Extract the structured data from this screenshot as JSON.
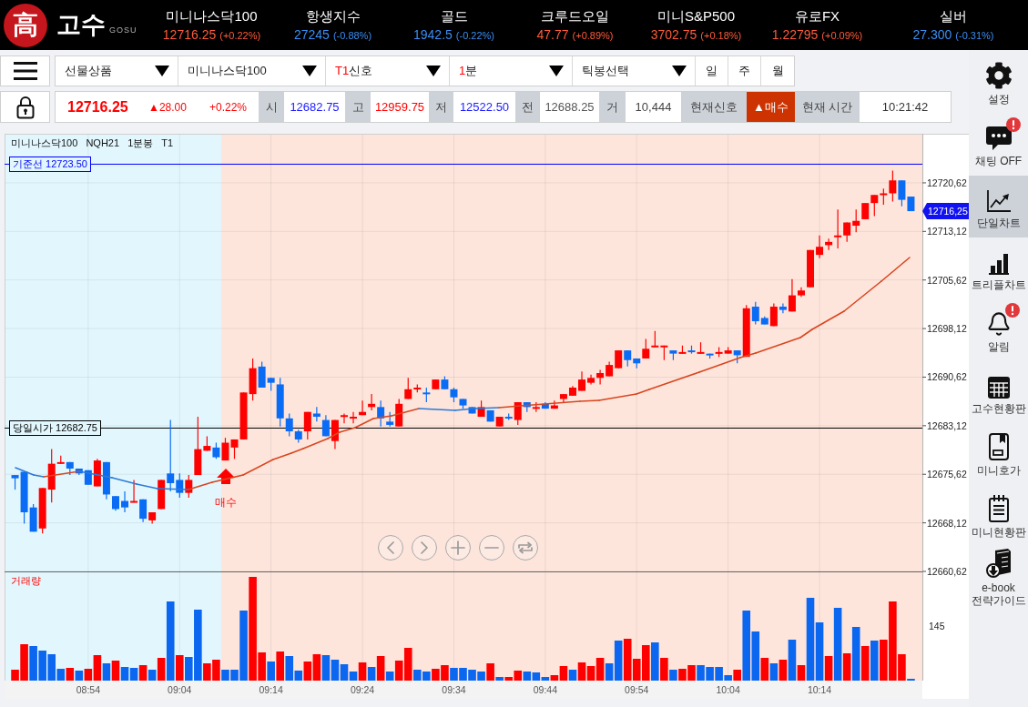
{
  "header": {
    "logo": {
      "emblem": "高",
      "name": "고수",
      "subtitle": "GOSU"
    },
    "tickers": [
      {
        "name": "미니나스닥100",
        "value": "12716.25",
        "change": "(+0.22%)",
        "rising": true
      },
      {
        "name": "항생지수",
        "value": "27245",
        "change": "(-0.88%)",
        "rising": false
      },
      {
        "name": "골드",
        "value": "1942.5",
        "change": "(-0.22%)",
        "rising": false
      },
      {
        "name": "크루드오일",
        "value": "47.77",
        "change": "(+0.89%)",
        "rising": true
      },
      {
        "name": "미니S&P500",
        "value": "3702.75",
        "change": "(+0.18%)",
        "rising": true
      },
      {
        "name": "유로FX",
        "value": "1.22795",
        "change": "(+0.09%)",
        "rising": true
      },
      {
        "name": "실버",
        "value": "27.300",
        "change": "(-0.31%)",
        "rising": false
      }
    ]
  },
  "selectors": [
    {
      "label": "선물상품"
    },
    {
      "label": "미니나스닥100"
    },
    {
      "accent": "T1",
      "label": "신호"
    },
    {
      "accent": "1",
      "label": "분"
    },
    {
      "label": "틱봉선택"
    }
  ],
  "period_buttons": [
    {
      "label": "일"
    },
    {
      "label": "주"
    },
    {
      "label": "월"
    }
  ],
  "quote": {
    "price": "12716.25",
    "change": "▲28.00",
    "rate": "+0.22%",
    "rising": true,
    "fields": [
      {
        "label": "시",
        "value": "12682.75",
        "color": "#1a1aff"
      },
      {
        "label": "고",
        "value": "12959.75",
        "color": "#ff0000"
      },
      {
        "label": "저",
        "value": "12522.50",
        "color": "#1a1aff"
      },
      {
        "label": "전",
        "value": "12688.25",
        "color": "#555555"
      },
      {
        "label": "거",
        "value": "10,444",
        "color": "#444444"
      }
    ],
    "signal": {
      "label": "현재신호",
      "value": "▲매수",
      "kind": "buy"
    },
    "time": {
      "label": "현재 시간",
      "value": "10:21:42"
    }
  },
  "chart": {
    "chart_data": {
      "type": "candlestick",
      "title": "미니나스닥100 NQH21 1분봉 T1",
      "x": [
        526,
        527,
        528,
        529,
        530,
        531,
        532,
        533,
        534,
        535,
        536,
        537,
        538,
        539,
        540,
        541,
        542,
        543,
        544,
        545,
        546,
        547,
        548,
        549,
        550,
        551,
        552,
        553,
        554,
        555,
        556,
        557,
        558,
        559,
        560,
        561,
        562,
        563,
        564,
        565,
        566,
        567,
        568,
        569,
        570,
        571,
        572,
        573,
        574,
        575,
        576,
        577,
        578,
        579,
        580,
        581,
        582,
        583,
        584,
        585,
        586,
        587,
        588,
        589,
        590,
        591,
        592,
        593,
        594,
        595,
        596,
        597,
        598,
        599,
        600,
        601,
        602,
        603,
        604,
        605,
        606,
        607,
        608,
        609,
        610,
        611,
        612,
        613,
        614,
        615,
        616,
        617,
        618,
        619,
        620,
        621,
        622,
        623,
        624
      ],
      "xlim": [
        524.85,
        625.25
      ],
      "ohlc": [
        [
          12675.5,
          12675.5,
          12673.25,
          12675
        ],
        [
          12676,
          12676,
          12668,
          12669.75
        ],
        [
          12670.5,
          12671,
          12666.75,
          12666.75
        ],
        [
          12667.25,
          12673.5,
          12666.5,
          12673.5
        ],
        [
          12673.25,
          12679.5,
          12671.25,
          12677.25
        ],
        [
          12677.25,
          12678.5,
          12677.25,
          12677.5
        ],
        [
          12677.5,
          12677.5,
          12675.5,
          12676.5
        ],
        [
          12676.5,
          12676.5,
          12675.5,
          12675.75
        ],
        [
          12676.25,
          12676.25,
          12674,
          12674
        ],
        [
          12673.75,
          12678,
          12673.75,
          12677.75
        ],
        [
          12677.5,
          12677.5,
          12671.75,
          12672.5
        ],
        [
          12672.25,
          12672.25,
          12670,
          12670.25
        ],
        [
          12671.5,
          12673,
          12669.75,
          12670.5
        ],
        [
          12671.25,
          12674.75,
          12671.25,
          12671.5
        ],
        [
          12671.75,
          12671.75,
          12668.25,
          12668.75
        ],
        [
          12668.5,
          12669.75,
          12668,
          12669.75
        ],
        [
          12670.25,
          12674.75,
          12670.25,
          12674.75
        ],
        [
          12675.75,
          12684,
          12673,
          12674.25
        ],
        [
          12674.75,
          12675.75,
          12672,
          12672.75
        ],
        [
          12672.75,
          12675.5,
          12672,
          12674.75
        ],
        [
          12675.5,
          12684.5,
          12675.5,
          12679.5
        ],
        [
          12679.25,
          12681.5,
          12679.25,
          12680
        ],
        [
          12679.75,
          12680.5,
          12678,
          12678.25
        ],
        [
          12677.75,
          12681.25,
          12677.75,
          12680.5
        ],
        [
          12679.75,
          12681,
          12678,
          12681
        ],
        [
          12681,
          12688.25,
          12681,
          12688.25
        ],
        [
          12688,
          12693.5,
          12687,
          12692
        ],
        [
          12692.25,
          12693,
          12689,
          12689
        ],
        [
          12690.5,
          12690.5,
          12688.5,
          12689.75
        ],
        [
          12689.5,
          12690.5,
          12683,
          12684.25
        ],
        [
          12684.25,
          12685,
          12681.5,
          12682.25
        ],
        [
          12682.25,
          12682.5,
          12680.5,
          12681
        ],
        [
          12682.25,
          12685.25,
          12681,
          12685.25
        ],
        [
          12685,
          12686,
          12683.75,
          12684.5
        ],
        [
          12684,
          12684.75,
          12681.5,
          12681.5
        ],
        [
          12680.75,
          12684,
          12679.5,
          12684
        ],
        [
          12684.5,
          12685,
          12683.5,
          12684.75
        ],
        [
          12684.25,
          12685.25,
          12683.5,
          12684.5
        ],
        [
          12684.75,
          12687,
          12684.75,
          12685.25
        ],
        [
          12686,
          12688,
          12685.5,
          12686.5
        ],
        [
          12686,
          12687,
          12683,
          12684.25
        ],
        [
          12683.75,
          12685.25,
          12683,
          12683.25
        ],
        [
          12683,
          12687.25,
          12683,
          12686.5
        ],
        [
          12687.25,
          12690.5,
          12687.25,
          12688.75
        ],
        [
          12688.75,
          12689.5,
          12688.25,
          12689
        ],
        [
          12688.25,
          12689,
          12686.75,
          12688
        ],
        [
          12688.75,
          12690.25,
          12688.75,
          12690.25
        ],
        [
          12690.25,
          12690.75,
          12688.75,
          12688.75
        ],
        [
          12688.75,
          12689,
          12686.75,
          12687.5
        ],
        [
          12687.25,
          12687.25,
          12685.75,
          12686.25
        ],
        [
          12686,
          12686,
          12685,
          12685
        ],
        [
          12684.5,
          12687,
          12684.5,
          12686
        ],
        [
          12685.5,
          12685.5,
          12683.75,
          12683.75
        ],
        [
          12683,
          12684.5,
          12683,
          12684.5
        ],
        [
          12684.5,
          12685,
          12684,
          12684.25
        ],
        [
          12684,
          12686.75,
          12683.25,
          12686.75
        ],
        [
          12686.75,
          12686.75,
          12685.25,
          12686
        ],
        [
          12685.75,
          12686.75,
          12685.25,
          12686
        ],
        [
          12686.5,
          12686.75,
          12685.75,
          12685.75
        ],
        [
          12685.75,
          12687,
          12685.75,
          12686.25
        ],
        [
          12687.25,
          12688,
          12686.75,
          12688
        ],
        [
          12687.75,
          12689.25,
          12687.75,
          12689
        ],
        [
          12688.5,
          12691.5,
          12688.5,
          12690.25
        ],
        [
          12689.75,
          12691,
          12689.5,
          12690.5
        ],
        [
          12690.5,
          12691.75,
          12689.5,
          12691.25
        ],
        [
          12690.75,
          12693,
          12690.75,
          12692.5
        ],
        [
          12692,
          12694.75,
          12692,
          12694.75
        ],
        [
          12694.75,
          12694.75,
          12692.25,
          12693.25
        ],
        [
          12693.5,
          12693.5,
          12692,
          12692.75
        ],
        [
          12693.5,
          12696.5,
          12693.5,
          12695
        ],
        [
          12695.25,
          12697.75,
          12695.25,
          12695.5
        ],
        [
          12695.25,
          12695.5,
          12693.25,
          12695.5
        ],
        [
          12694.75,
          12694.75,
          12693.25,
          12694.25
        ],
        [
          12694.25,
          12695.5,
          12694.25,
          12694.5
        ],
        [
          12694.75,
          12695.5,
          12694.25,
          12694.5
        ],
        [
          12694.25,
          12696,
          12694.25,
          12694.5
        ],
        [
          12694.25,
          12694.25,
          12693.5,
          12694
        ],
        [
          12694.25,
          12695.25,
          12693.75,
          12694.5
        ],
        [
          12694.25,
          12695.25,
          12694.25,
          12694.75
        ],
        [
          12694.75,
          12694.75,
          12692.75,
          12694
        ],
        [
          12693.75,
          12701.75,
          12693.75,
          12701.25
        ],
        [
          12701.5,
          12702.25,
          12698.75,
          12699.25
        ],
        [
          12699.75,
          12700,
          12698.75,
          12698.75
        ],
        [
          12698.5,
          12702,
          12698.5,
          12701.5
        ],
        [
          12701.5,
          12702,
          12700.5,
          12701
        ],
        [
          12700.75,
          12705.75,
          12700.75,
          12703.25
        ],
        [
          12703.25,
          12704.5,
          12703,
          12704
        ],
        [
          12704.5,
          12710.25,
          12704.5,
          12710.25
        ],
        [
          12709.5,
          12712.5,
          12709,
          12710.75
        ],
        [
          12711,
          12712,
          12710.25,
          12711.5
        ],
        [
          12712.25,
          12716.5,
          12710.5,
          12712.5
        ],
        [
          12712.5,
          12714.5,
          12711.5,
          12714.5
        ],
        [
          12714,
          12716.5,
          12713,
          12714.75
        ],
        [
          12715,
          12717.5,
          12715,
          12717.5
        ],
        [
          12717.5,
          12718.75,
          12715.5,
          12718.75
        ],
        [
          12718.75,
          12719.75,
          12717.25,
          12719
        ],
        [
          12719,
          12722.5,
          12717.75,
          12721
        ],
        [
          12721,
          12721,
          12717,
          12718
        ],
        [
          12718.5,
          12718.5,
          12716.25,
          12716.25
        ]
      ],
      "xticks": [
        {
          "value": 534,
          "label": "08:54"
        },
        {
          "value": 544,
          "label": "09:04"
        },
        {
          "value": 554,
          "label": "09:14"
        },
        {
          "value": 564,
          "label": "09:24"
        },
        {
          "value": 574,
          "label": "09:34"
        },
        {
          "value": 584,
          "label": "09:44"
        },
        {
          "value": 594,
          "label": "09:54"
        },
        {
          "value": 604,
          "label": "10:04"
        },
        {
          "value": 614,
          "label": "10:14"
        }
      ],
      "yticks": [
        {
          "value": 12720.62,
          "label": "12720,62"
        },
        {
          "value": 12713.12,
          "label": "12713,12"
        },
        {
          "value": 12705.62,
          "label": "12705,62"
        },
        {
          "value": 12698.12,
          "label": "12698,12"
        },
        {
          "value": 12690.62,
          "label": "12690,62"
        },
        {
          "value": 12683.12,
          "label": "12683,12"
        },
        {
          "value": 12675.62,
          "label": "12675,62"
        },
        {
          "value": 12668.12,
          "label": "12668,12"
        },
        {
          "value": 12660.62,
          "label": "12660,62"
        }
      ],
      "ylim": [
        12643.76,
        12728.2
      ],
      "grid": true,
      "ref_lines": [
        {
          "axis": "y",
          "value": 12723.5,
          "label": "기준선 12723.50",
          "color": "#0000ff"
        },
        {
          "axis": "y",
          "value": 12682.75,
          "label": "당일시가 12682.75",
          "color": "#000000"
        }
      ],
      "bands": [
        {
          "axis": "x",
          "from": 524.85,
          "to": 548.56,
          "color": "#e2f7fd"
        },
        {
          "axis": "x",
          "from": 548.56,
          "to": 625.25,
          "color": "#fde5dc"
        }
      ]
    },
    "current_price": "12716,25",
    "signal_marker": {
      "kind": "buy",
      "label": "매수"
    },
    "nav_buttons": [
      {
        "kind": "prev"
      },
      {
        "kind": "next"
      },
      {
        "kind": "zoom-in"
      },
      {
        "kind": "zoom-out"
      },
      {
        "kind": "reset"
      }
    ],
    "volume": {
      "title": "거래량",
      "axis_label": "145"
    }
  },
  "sidebar": {
    "items": [
      {
        "kind": "settings",
        "label": "설정",
        "alert": false,
        "selected": false
      },
      {
        "kind": "chat",
        "label": "채팅 OFF",
        "alert": true,
        "selected": false
      },
      {
        "kind": "single-chart",
        "label": "단일차트",
        "alert": false,
        "selected": true
      },
      {
        "kind": "triple-chart",
        "label": "트리플차트",
        "alert": false,
        "selected": false
      },
      {
        "kind": "alarm",
        "label": "알림",
        "alert": true,
        "selected": false
      },
      {
        "kind": "board",
        "label": "고수현황판",
        "alert": false,
        "selected": false
      },
      {
        "kind": "mini-quote",
        "label": "미니호가",
        "alert": false,
        "selected": false
      },
      {
        "kind": "mini-board",
        "label": "미니현황판",
        "alert": false,
        "selected": false
      },
      {
        "kind": "ebook",
        "label": "e-book 전략가이드",
        "alert": false,
        "selected": false
      }
    ]
  }
}
